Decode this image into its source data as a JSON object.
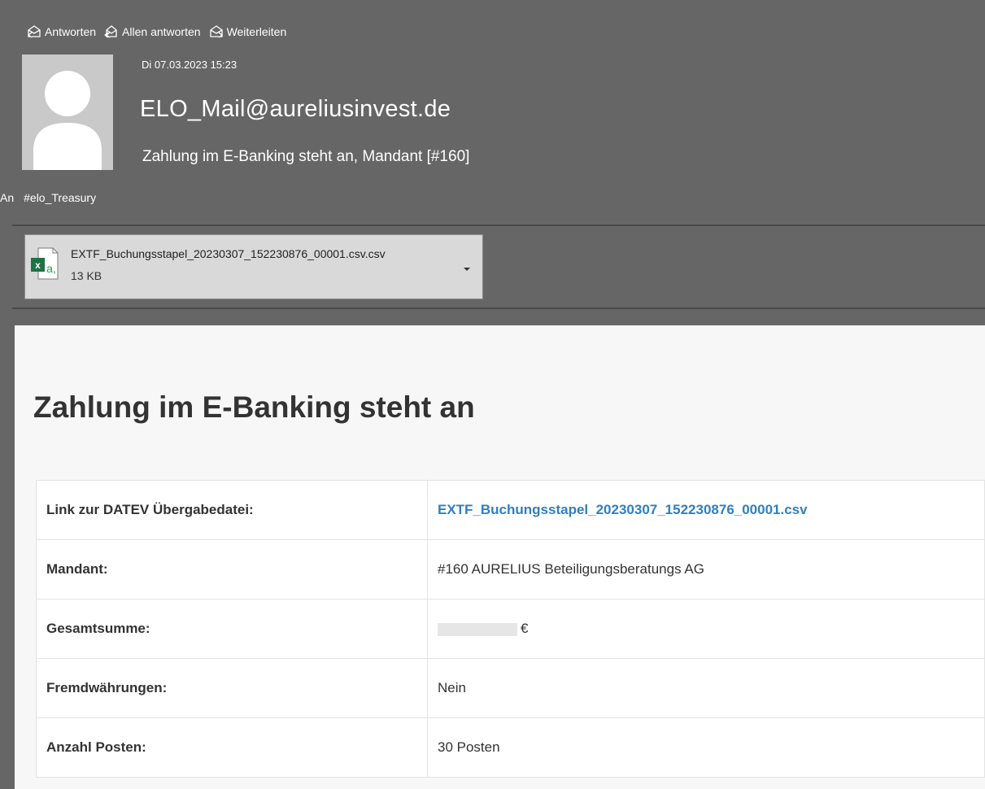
{
  "toolbar": {
    "reply_label": "Antworten",
    "reply_all_label": "Allen antworten",
    "forward_label": "Weiterleiten"
  },
  "message": {
    "date": "Di 07.03.2023 15:23",
    "sender": "ELO_Mail@aureliusinvest.de",
    "subject": "Zahlung im E-Banking steht an, Mandant [#160]",
    "to_label": "An",
    "to_value": "#elo_Treasury"
  },
  "attachment": {
    "name": "EXTF_Buchungsstapel_20230307_152230876_00001.csv.csv",
    "size": "13 KB",
    "icon": "excel-csv-file-icon"
  },
  "body": {
    "title": "Zahlung im E-Banking steht an",
    "rows": [
      {
        "label": "Link zur DATEV Übergabedatei:",
        "value": "EXTF_Buchungsstapel_20230307_152230876_00001.csv"
      },
      {
        "label": "Mandant:",
        "value": "#160 AURELIUS Beteiligungsberatungs AG"
      },
      {
        "label": "Gesamtsumme:",
        "value": "€"
      },
      {
        "label": "Fremdwährungen:",
        "value": "Nein"
      },
      {
        "label": "Anzahl Posten:",
        "value": "30 Posten"
      }
    ]
  },
  "colors": {
    "header_bg": "#666666",
    "link": "#2f7fc1",
    "excel_green": "#1f7244"
  }
}
